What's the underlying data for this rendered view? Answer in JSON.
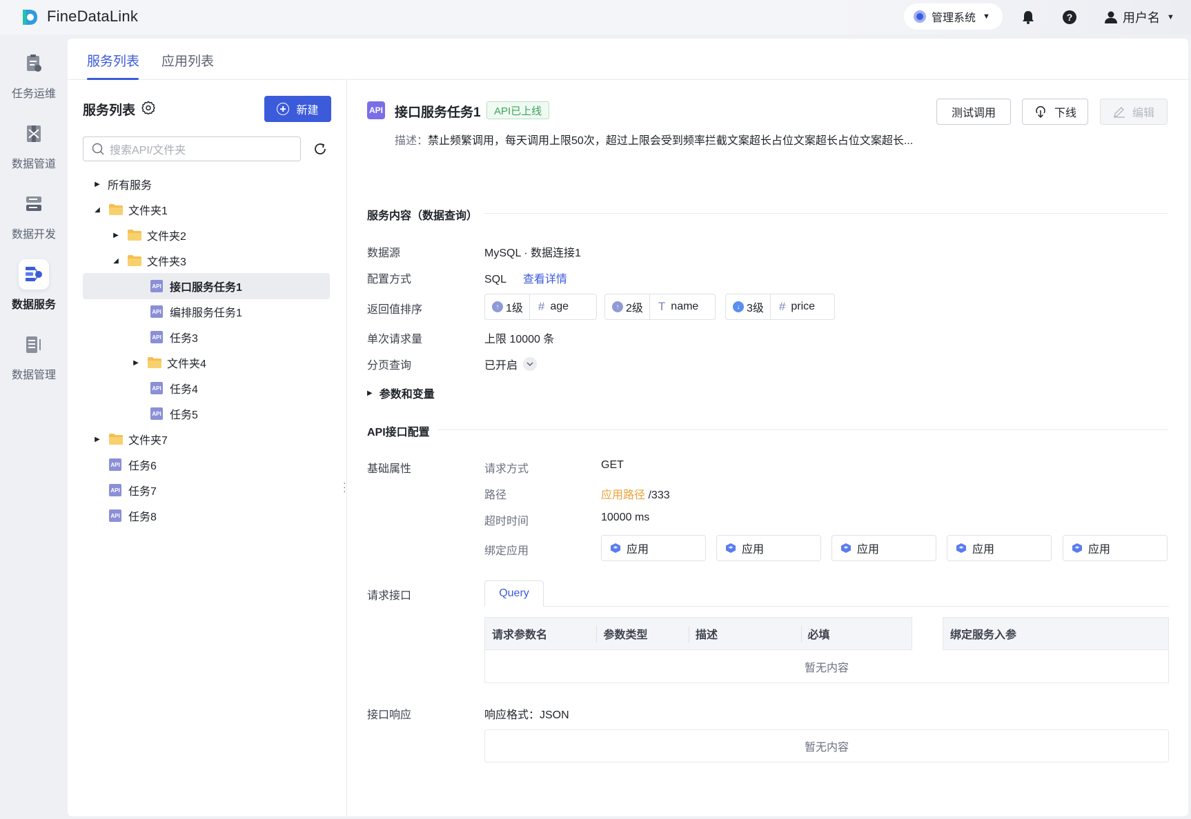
{
  "app": {
    "brand": "FineDataLink"
  },
  "topbar": {
    "system_switch": "管理系统",
    "user_name": "用户名"
  },
  "nav": {
    "items": [
      {
        "label": "任务运维",
        "icon": "task-ops-icon"
      },
      {
        "label": "数据管道",
        "icon": "data-pipeline-icon"
      },
      {
        "label": "数据开发",
        "icon": "data-dev-icon"
      },
      {
        "label": "数据服务",
        "icon": "data-service-icon",
        "active": true
      },
      {
        "label": "数据管理",
        "icon": "data-manage-icon"
      }
    ]
  },
  "tabs": [
    {
      "label": "服务列表",
      "active": true
    },
    {
      "label": "应用列表"
    }
  ],
  "tree": {
    "title": "服务列表",
    "new_button": "新建",
    "search_placeholder": "搜索API/文件夹",
    "rows": [
      {
        "label": "所有服务",
        "type": "root",
        "expanded": false
      },
      {
        "label": "文件夹1",
        "type": "folder",
        "expanded": true
      },
      {
        "label": "文件夹2",
        "type": "folder",
        "expanded": false
      },
      {
        "label": "文件夹3",
        "type": "folder",
        "expanded": true
      },
      {
        "label": "接口服务任务1",
        "type": "api",
        "selected": true
      },
      {
        "label": "编排服务任务1",
        "type": "api"
      },
      {
        "label": "任务3",
        "type": "api"
      },
      {
        "label": "文件夹4",
        "type": "folder",
        "expanded": false
      },
      {
        "label": "任务4",
        "type": "api"
      },
      {
        "label": "任务5",
        "type": "api"
      },
      {
        "label": "文件夹7",
        "type": "folder",
        "expanded": false
      },
      {
        "label": "任务6",
        "type": "api"
      },
      {
        "label": "任务7",
        "type": "api"
      },
      {
        "label": "任务8",
        "type": "api"
      }
    ]
  },
  "detail": {
    "api_badge": "API",
    "title": "接口服务任务1",
    "status": "API已上线",
    "desc_label": "描述：",
    "desc": "禁止频繁调用，每天调用上限50次，超过上限会受到频率拦截文案超长占位文案超长占位文案超长...",
    "buttons": {
      "test": "测试调用",
      "offline": "下线",
      "edit": "编辑"
    },
    "content_section": "服务内容（数据查询）",
    "datasource_label": "数据源",
    "datasource_value": "MySQL · 数据连接1",
    "config_label": "配置方式",
    "config_value": "SQL",
    "config_link": "查看详情",
    "sort_label": "返回值排序",
    "sorts": [
      {
        "level": "1级",
        "dir": "up",
        "field_icon": "#",
        "field": "age"
      },
      {
        "level": "2级",
        "dir": "up",
        "field_icon": "T",
        "field": "name"
      },
      {
        "level": "3级",
        "dir": "down",
        "field_icon": "#",
        "field": "price"
      }
    ],
    "request_limit_label": "单次请求量",
    "request_limit_value": "上限 10000 条",
    "paging_label": "分页查询",
    "paging_value": "已开启",
    "params_toggle": "参数和变量",
    "api_section": "API接口配置",
    "basic_label": "基础属性",
    "method_label": "请求方式",
    "method_value": "GET",
    "path_label": "路径",
    "path_prefix": "应用路径",
    "path_value": "/333",
    "timeout_label": "超时时间",
    "timeout_value": "10000 ms",
    "bind_label": "绑定应用",
    "bound_apps": [
      "应用",
      "应用",
      "应用",
      "应用",
      "应用"
    ],
    "request_label": "请求接口",
    "query_tab": "Query",
    "table_headers": [
      "请求参数名",
      "参数类型",
      "描述",
      "必填"
    ],
    "bind_header": "绑定服务入参",
    "empty": "暂无内容",
    "response_label": "接口响应",
    "response_format": "响应格式：JSON",
    "response_empty": "暂无内容"
  },
  "colors": {
    "primary": "#3b5bdb",
    "success": "#3aa55a",
    "warning": "#e8a23a",
    "api_purple": "#7a6ee8"
  }
}
